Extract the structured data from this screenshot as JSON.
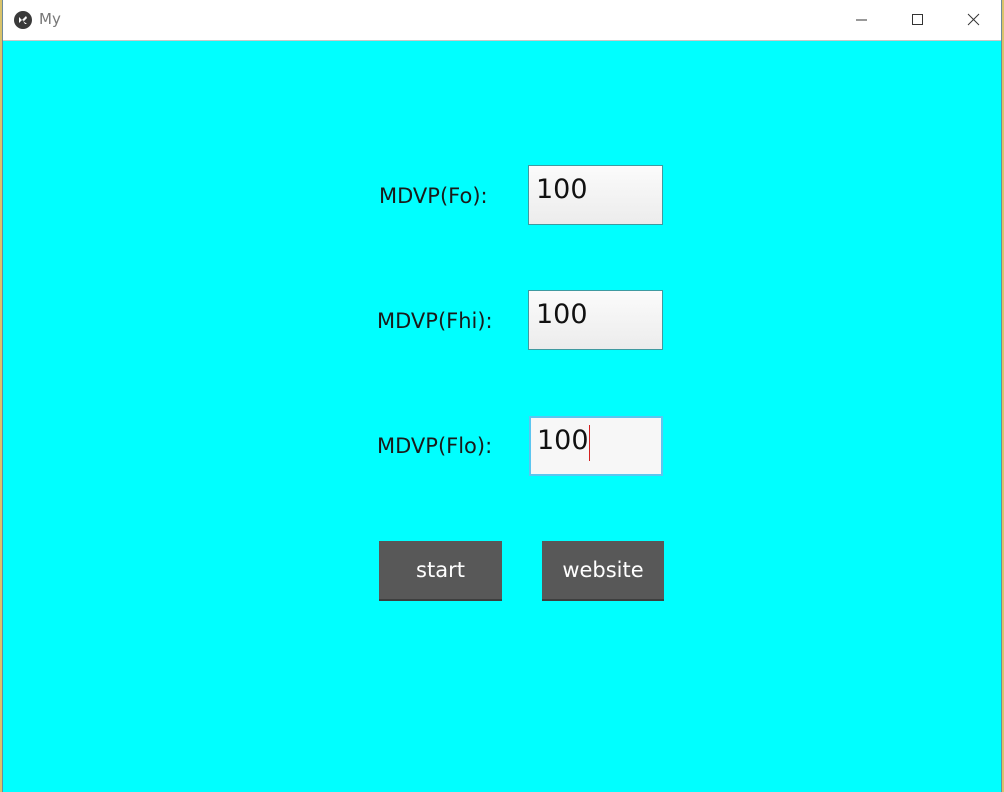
{
  "window": {
    "title": "My",
    "background_color": "#00ffff",
    "icons": {
      "app": "kivy-logo-icon",
      "minimize": "minimize-icon",
      "maximize": "maximize-icon",
      "close": "close-icon"
    }
  },
  "form": {
    "fields": [
      {
        "label": "MDVP(Fo):",
        "value": "100",
        "focused": false
      },
      {
        "label": "MDVP(Fhi):",
        "value": "100",
        "focused": false
      },
      {
        "label": "MDVP(Flo):",
        "value": "100",
        "focused": true
      }
    ],
    "buttons": {
      "start_label": "start",
      "website_label": "website"
    },
    "button_color": "#585858",
    "caret_color": "#d42020"
  }
}
